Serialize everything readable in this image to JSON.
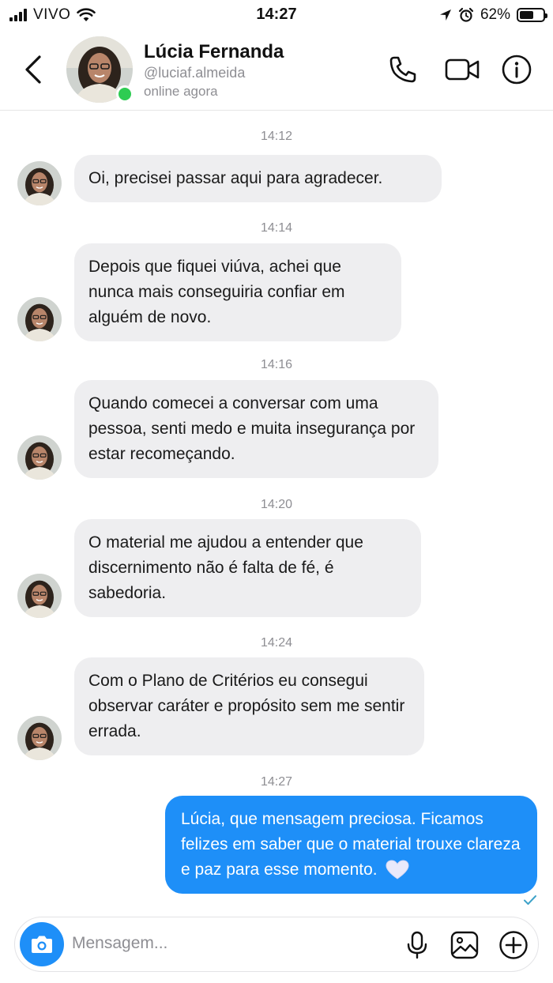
{
  "status_bar": {
    "carrier": "VIVO",
    "time": "14:27",
    "battery_percent": "62%",
    "battery_level": 0.62
  },
  "header": {
    "contact_name": "Lúcia Fernanda",
    "contact_handle": "@luciaf.almeida",
    "contact_status": "online agora",
    "icons": [
      "back-chevron-icon",
      "phone-icon",
      "video-camera-icon",
      "info-icon"
    ]
  },
  "messages": [
    {
      "time": "14:12",
      "direction": "incoming",
      "text": "Oi, precisei passar aqui para agradecer."
    },
    {
      "time": "14:14",
      "direction": "incoming",
      "text": "Depois que fiquei viúva, achei que nunca mais conseguiria confiar em alguém de novo."
    },
    {
      "time": "14:16",
      "direction": "incoming",
      "text": "Quando comecei a conversar com uma pessoa, senti medo e muita insegurança por estar recomeçando."
    },
    {
      "time": "14:20",
      "direction": "incoming",
      "text": "O material me ajudou a entender que discernimento não é falta de fé, é sabedoria."
    },
    {
      "time": "14:24",
      "direction": "incoming",
      "text": "Com o Plano de Critérios eu consegui observar caráter e propósito sem me sentir errada."
    },
    {
      "time": "14:27",
      "direction": "outgoing",
      "text": "Lúcia, que mensagem preciosa. Ficamos felizes em saber que o material trouxe clareza e paz para esse momento.",
      "emoji": "white-heart",
      "read": true
    }
  ],
  "composer": {
    "placeholder": "Mensagem...",
    "icons": [
      "camera-icon",
      "microphone-icon",
      "gallery-icon",
      "plus-icon"
    ]
  },
  "colors": {
    "accent": "#1e8ff8",
    "incoming_bubble": "#eeeef0",
    "online": "#2ecc52",
    "muted_text": "#8e8e93"
  }
}
